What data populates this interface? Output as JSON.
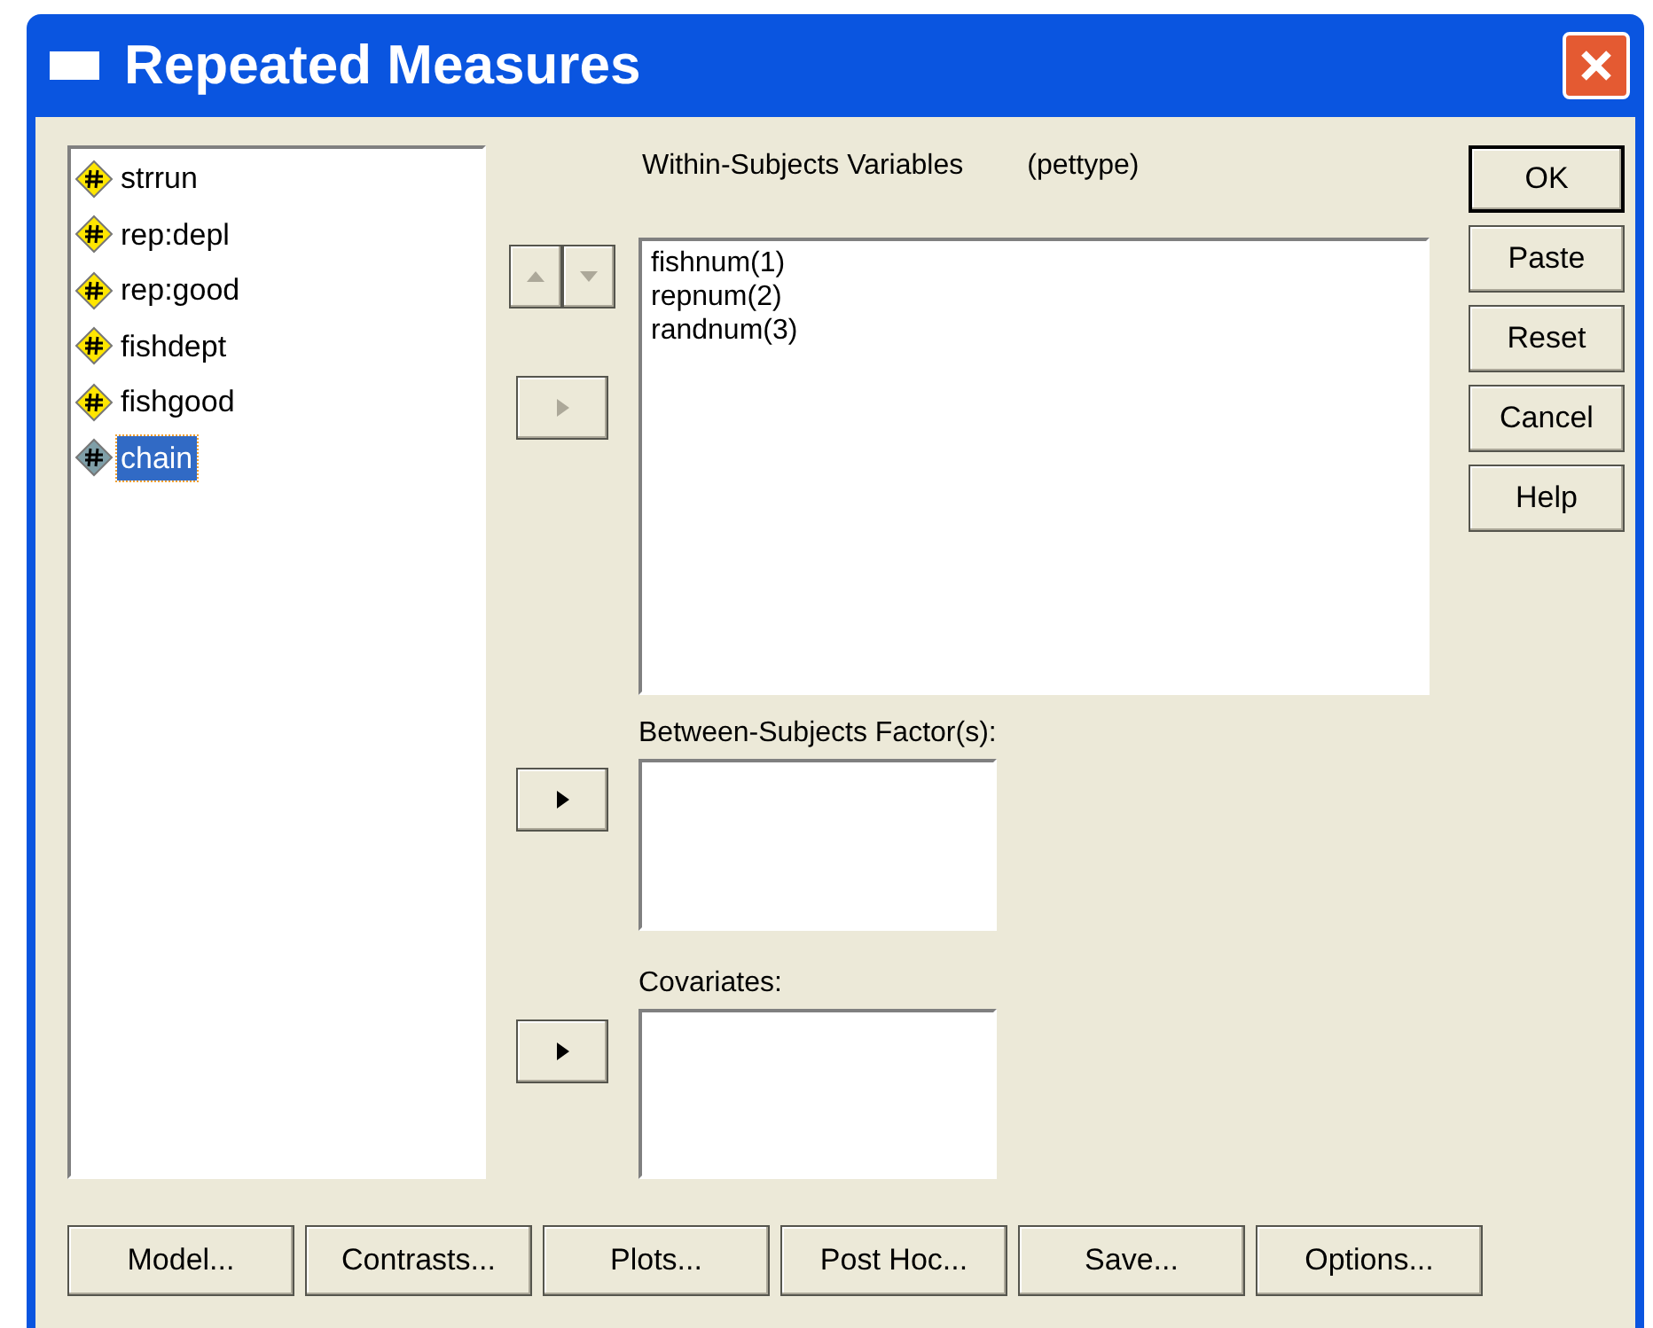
{
  "window": {
    "title": "Repeated Measures"
  },
  "variables": [
    {
      "name": "strrun",
      "selected": false
    },
    {
      "name": "rep:depl",
      "selected": false
    },
    {
      "name": "rep:good",
      "selected": false
    },
    {
      "name": "fishdept",
      "selected": false
    },
    {
      "name": "fishgood",
      "selected": false
    },
    {
      "name": "chain",
      "selected": true
    }
  ],
  "within": {
    "label": "Within-Subjects Variables",
    "factor": "(pettype)",
    "move_disabled": true,
    "order_disabled": true,
    "items": [
      "fishnum(1)",
      "repnum(2)",
      "randnum(3)"
    ]
  },
  "between": {
    "label": "Between-Subjects Factor(s):",
    "move_disabled": false
  },
  "covariates": {
    "label": "Covariates:",
    "move_disabled": false
  },
  "side_buttons": [
    {
      "label": "OK",
      "default": true
    },
    {
      "label": "Paste",
      "default": false
    },
    {
      "label": "Reset",
      "default": false
    },
    {
      "label": "Cancel",
      "default": false
    },
    {
      "label": "Help",
      "default": false
    }
  ],
  "bottom_buttons": [
    "Model...",
    "Contrasts...",
    "Plots...",
    "Post Hoc...",
    "Save...",
    "Options..."
  ]
}
